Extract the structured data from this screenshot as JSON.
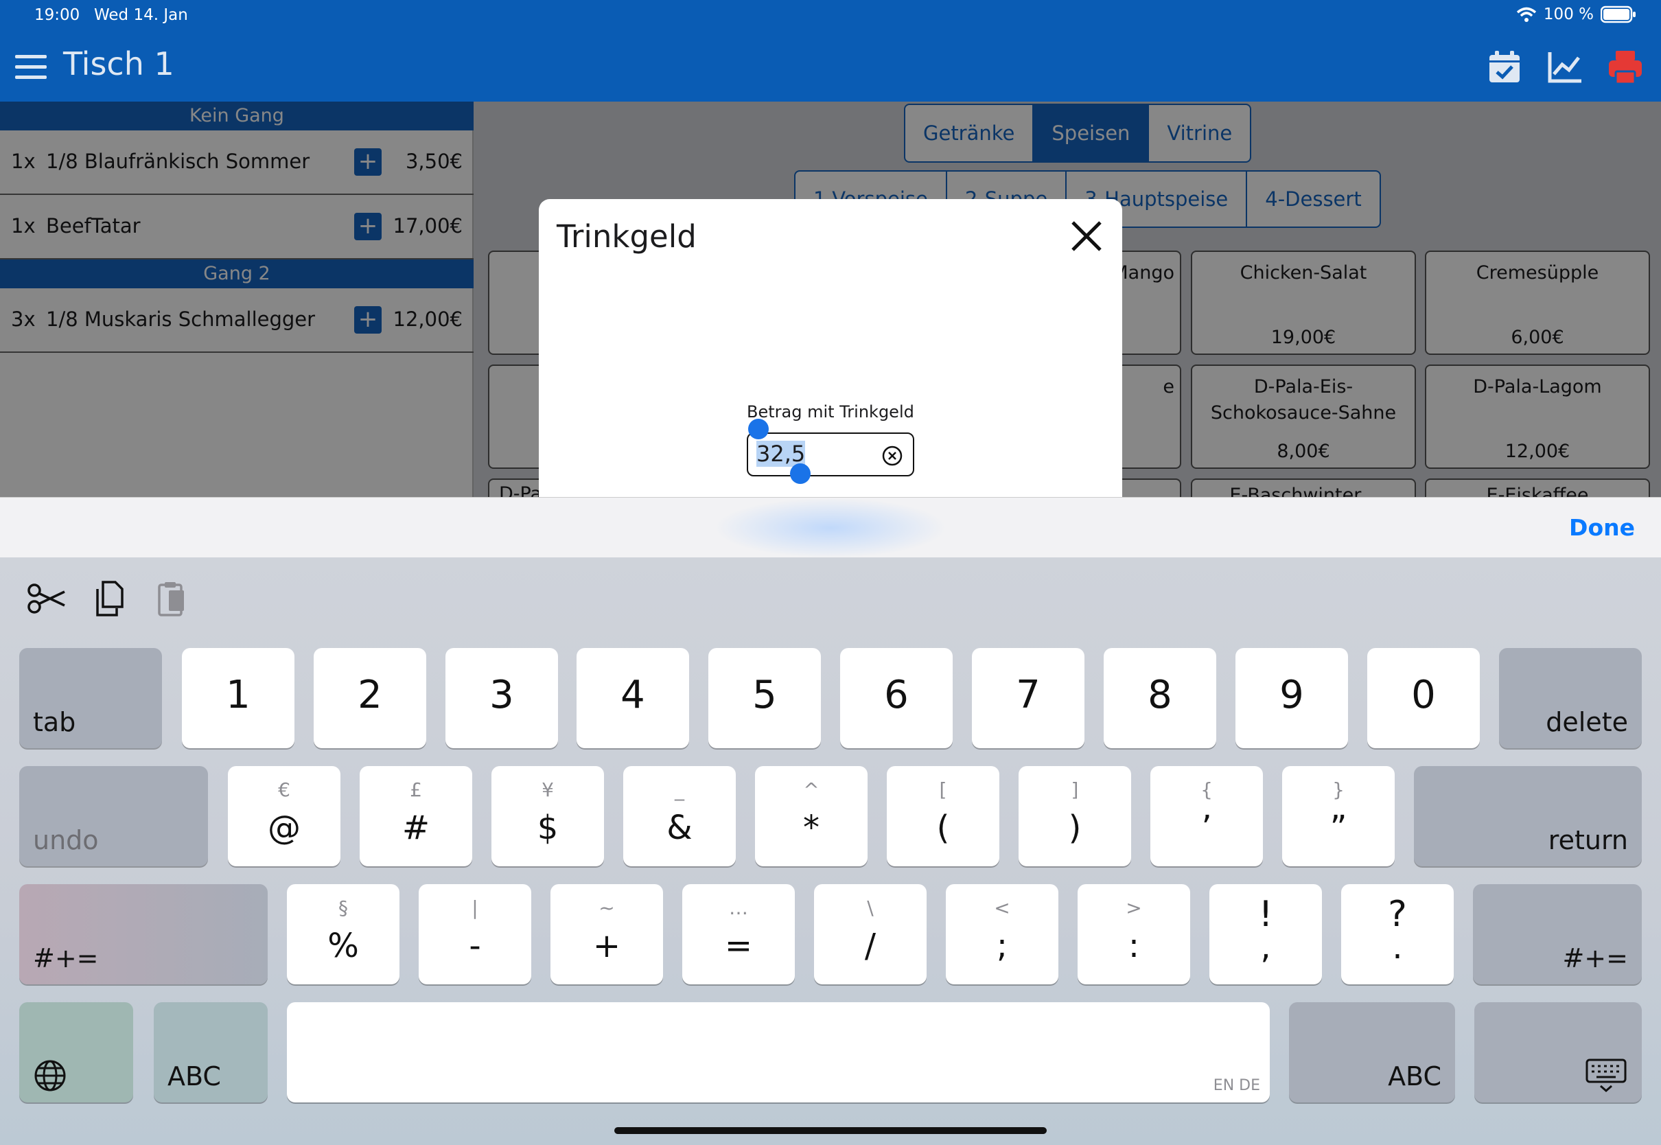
{
  "status": {
    "time": "19:00",
    "date": "Wed 14. Jan",
    "battery": "100 %"
  },
  "header": {
    "title": "Tisch 1"
  },
  "orders": {
    "gang1": "Kein Gang",
    "gang2": "Gang 2",
    "items": [
      {
        "qty": "1x",
        "name": "1/8 Blaufränkisch Sommer",
        "price": "3,50€"
      },
      {
        "qty": "1x",
        "name": "BeefTatar",
        "price": "17,00€"
      },
      {
        "qty": "3x",
        "name": "1/8 Muskaris Schmallegger",
        "price": "12,00€"
      }
    ],
    "plus": "+"
  },
  "tabs": [
    "Getränke",
    "Speisen",
    "Vitrine"
  ],
  "subtabs": [
    "1-Vorspeise",
    "2-Suppe",
    "3-Hauptspeise",
    "4-Dessert"
  ],
  "tiles": {
    "r1c3": {
      "name": "Mango"
    },
    "r1c4": {
      "name": "Chicken-Salat",
      "price": "19,00€"
    },
    "r1c5": {
      "name": "Cremesüpple",
      "price": "6,00€"
    },
    "r2c3": {
      "name": "e"
    },
    "r2c4": {
      "name": "D-Pala-Eis-Schokosauce-Sahne",
      "price": "8,00€"
    },
    "r2c5": {
      "name": "D-Pala-Lagom",
      "price": "12,00€"
    },
    "r3c1": {
      "name": "D-Pa"
    },
    "r3c4": {
      "name": "E-Baschwinter..."
    },
    "r3c5": {
      "name": "E-Eiskaffee"
    }
  },
  "modal": {
    "title": "Trinkgeld",
    "label": "Betrag mit Trinkgeld",
    "value": "32,5"
  },
  "accessory": {
    "done": "Done"
  },
  "keyboard": {
    "row1": [
      "1",
      "2",
      "3",
      "4",
      "5",
      "6",
      "7",
      "8",
      "9",
      "0"
    ],
    "row2_main": [
      "@",
      "#",
      "$",
      "&",
      "*",
      "(",
      ")",
      "’",
      "”"
    ],
    "row2_sub": [
      "€",
      "£",
      "¥",
      "_",
      "^",
      "[",
      "]",
      "{",
      "}"
    ],
    "row3_main": [
      "%",
      "-",
      "+",
      "=",
      "/",
      ";",
      ":",
      "!",
      "?"
    ],
    "row3_sub": [
      "§",
      "|",
      "~",
      "…",
      "\\",
      "<",
      ">",
      ",",
      "."
    ],
    "tab": "tab",
    "delete": "delete",
    "undo": "undo",
    "return": "return",
    "symbols": "#+=",
    "abc": "ABC",
    "langs": "EN DE"
  }
}
